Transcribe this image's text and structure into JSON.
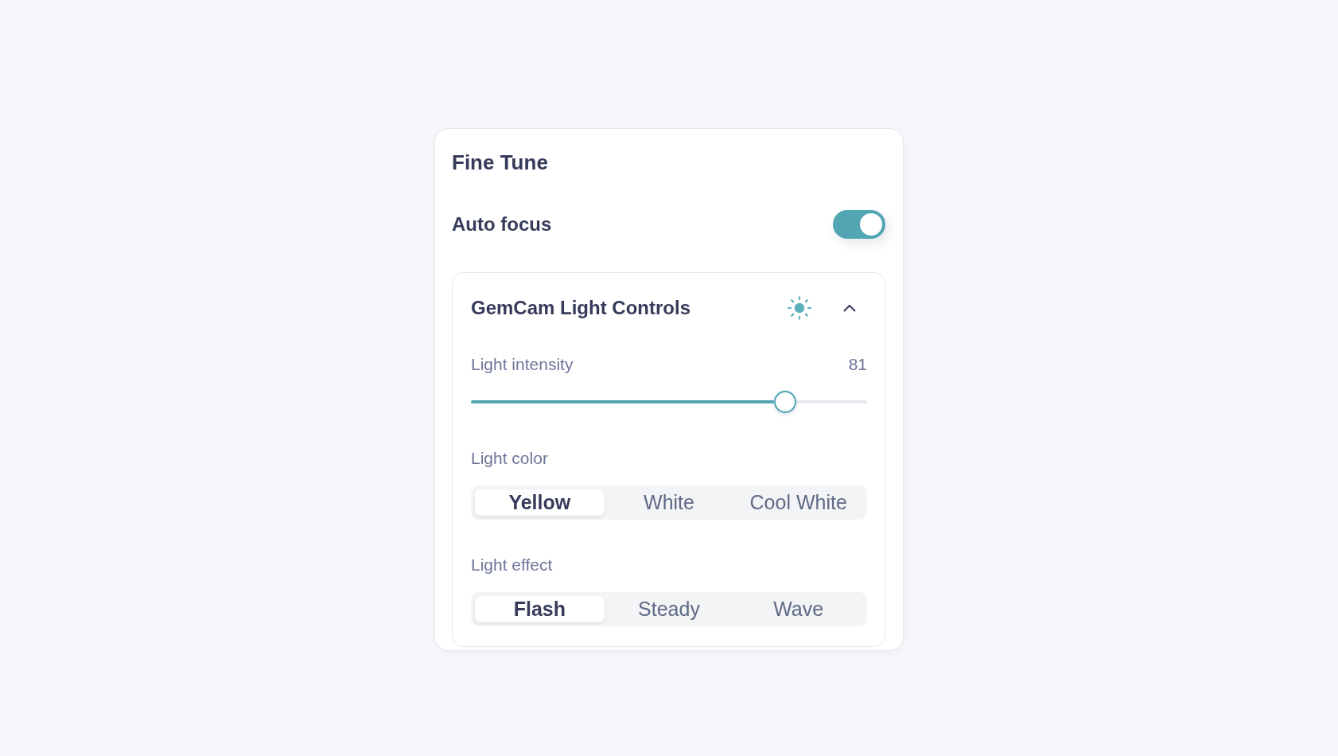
{
  "panel": {
    "title": "Fine Tune"
  },
  "auto_focus": {
    "label": "Auto focus",
    "on": true
  },
  "light_controls": {
    "title": "GemCam Light Controls",
    "expanded": true,
    "intensity": {
      "label": "Light intensity",
      "reading": "81",
      "level": 0.81
    },
    "color": {
      "label": "Light color",
      "options": [
        {
          "label": "Yellow",
          "selected": true
        },
        {
          "label": "White",
          "selected": false
        },
        {
          "label": "Cool White",
          "selected": false
        }
      ]
    },
    "effect": {
      "label": "Light effect",
      "options": [
        {
          "label": "Flash",
          "selected": true
        },
        {
          "label": "Steady",
          "selected": false
        },
        {
          "label": "Wave",
          "selected": false
        }
      ]
    }
  }
}
